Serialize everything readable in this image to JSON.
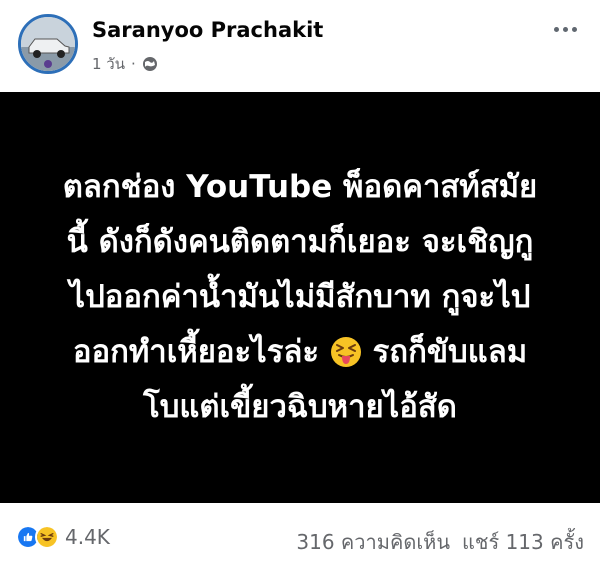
{
  "post": {
    "author": "Saranyoo Prachakit",
    "time": "1 วัน",
    "separator": "·",
    "visibility_icon": "globe-icon",
    "more_icon": "more-dots-icon"
  },
  "content": {
    "lines": [
      "ตลกช่อง YouTube พ็อดคาสท์สมัย",
      "นี้  ดังก็ดังคนติดตามก็เยอะ จะเชิญกู",
      "ไปออกค่าน้ำมันไม่มีสักบาท  กูจะไป",
      "ออกทำเหี้ยอะไรล่ะ",
      "รถก็ขับแลม",
      "โบแต่เขี้ยวฉิบหายไอ้สัด"
    ],
    "emoji": "squinting-face-with-tongue",
    "background_color": "#000000",
    "text_color": "#ffffff"
  },
  "footer": {
    "reaction_icons": [
      "like-icon",
      "haha-icon"
    ],
    "reaction_count": "4.4K",
    "comments": "316 ความคิดเห็น",
    "shares": "แชร์ 113 ครั้ง"
  }
}
